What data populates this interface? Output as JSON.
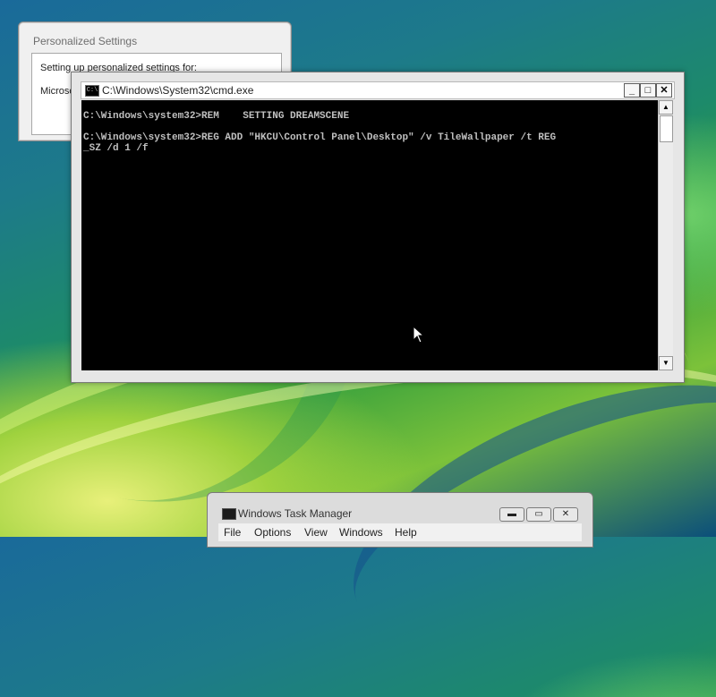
{
  "personalized_settings": {
    "title": "Personalized Settings",
    "line1": "Setting up personalized settings for:",
    "line2": "Microso"
  },
  "cmd": {
    "title": "C:\\Windows\\System32\\cmd.exe",
    "icon_text": "C:\\",
    "output": "C:\\Windows\\system32>REM    SETTING DREAMSCENE\n\nC:\\Windows\\system32>REG ADD \"HKCU\\Control Panel\\Desktop\" /v TileWallpaper /t REG\n_SZ /d 1 /f",
    "buttons": {
      "minimize": "_",
      "maximize": "□",
      "close": "✕"
    },
    "scroll_up": "▲",
    "scroll_down": "▼"
  },
  "task_manager": {
    "title": "Windows Task Manager",
    "buttons": {
      "minimize": "▬",
      "maximize": "▭",
      "close": "✕"
    },
    "menu": [
      "File",
      "Options",
      "View",
      "Windows",
      "Help"
    ]
  },
  "icons": {
    "cmd_icon": "console-icon",
    "task_manager_icon": "task-manager-icon",
    "cursor": "mouse-pointer-icon"
  }
}
